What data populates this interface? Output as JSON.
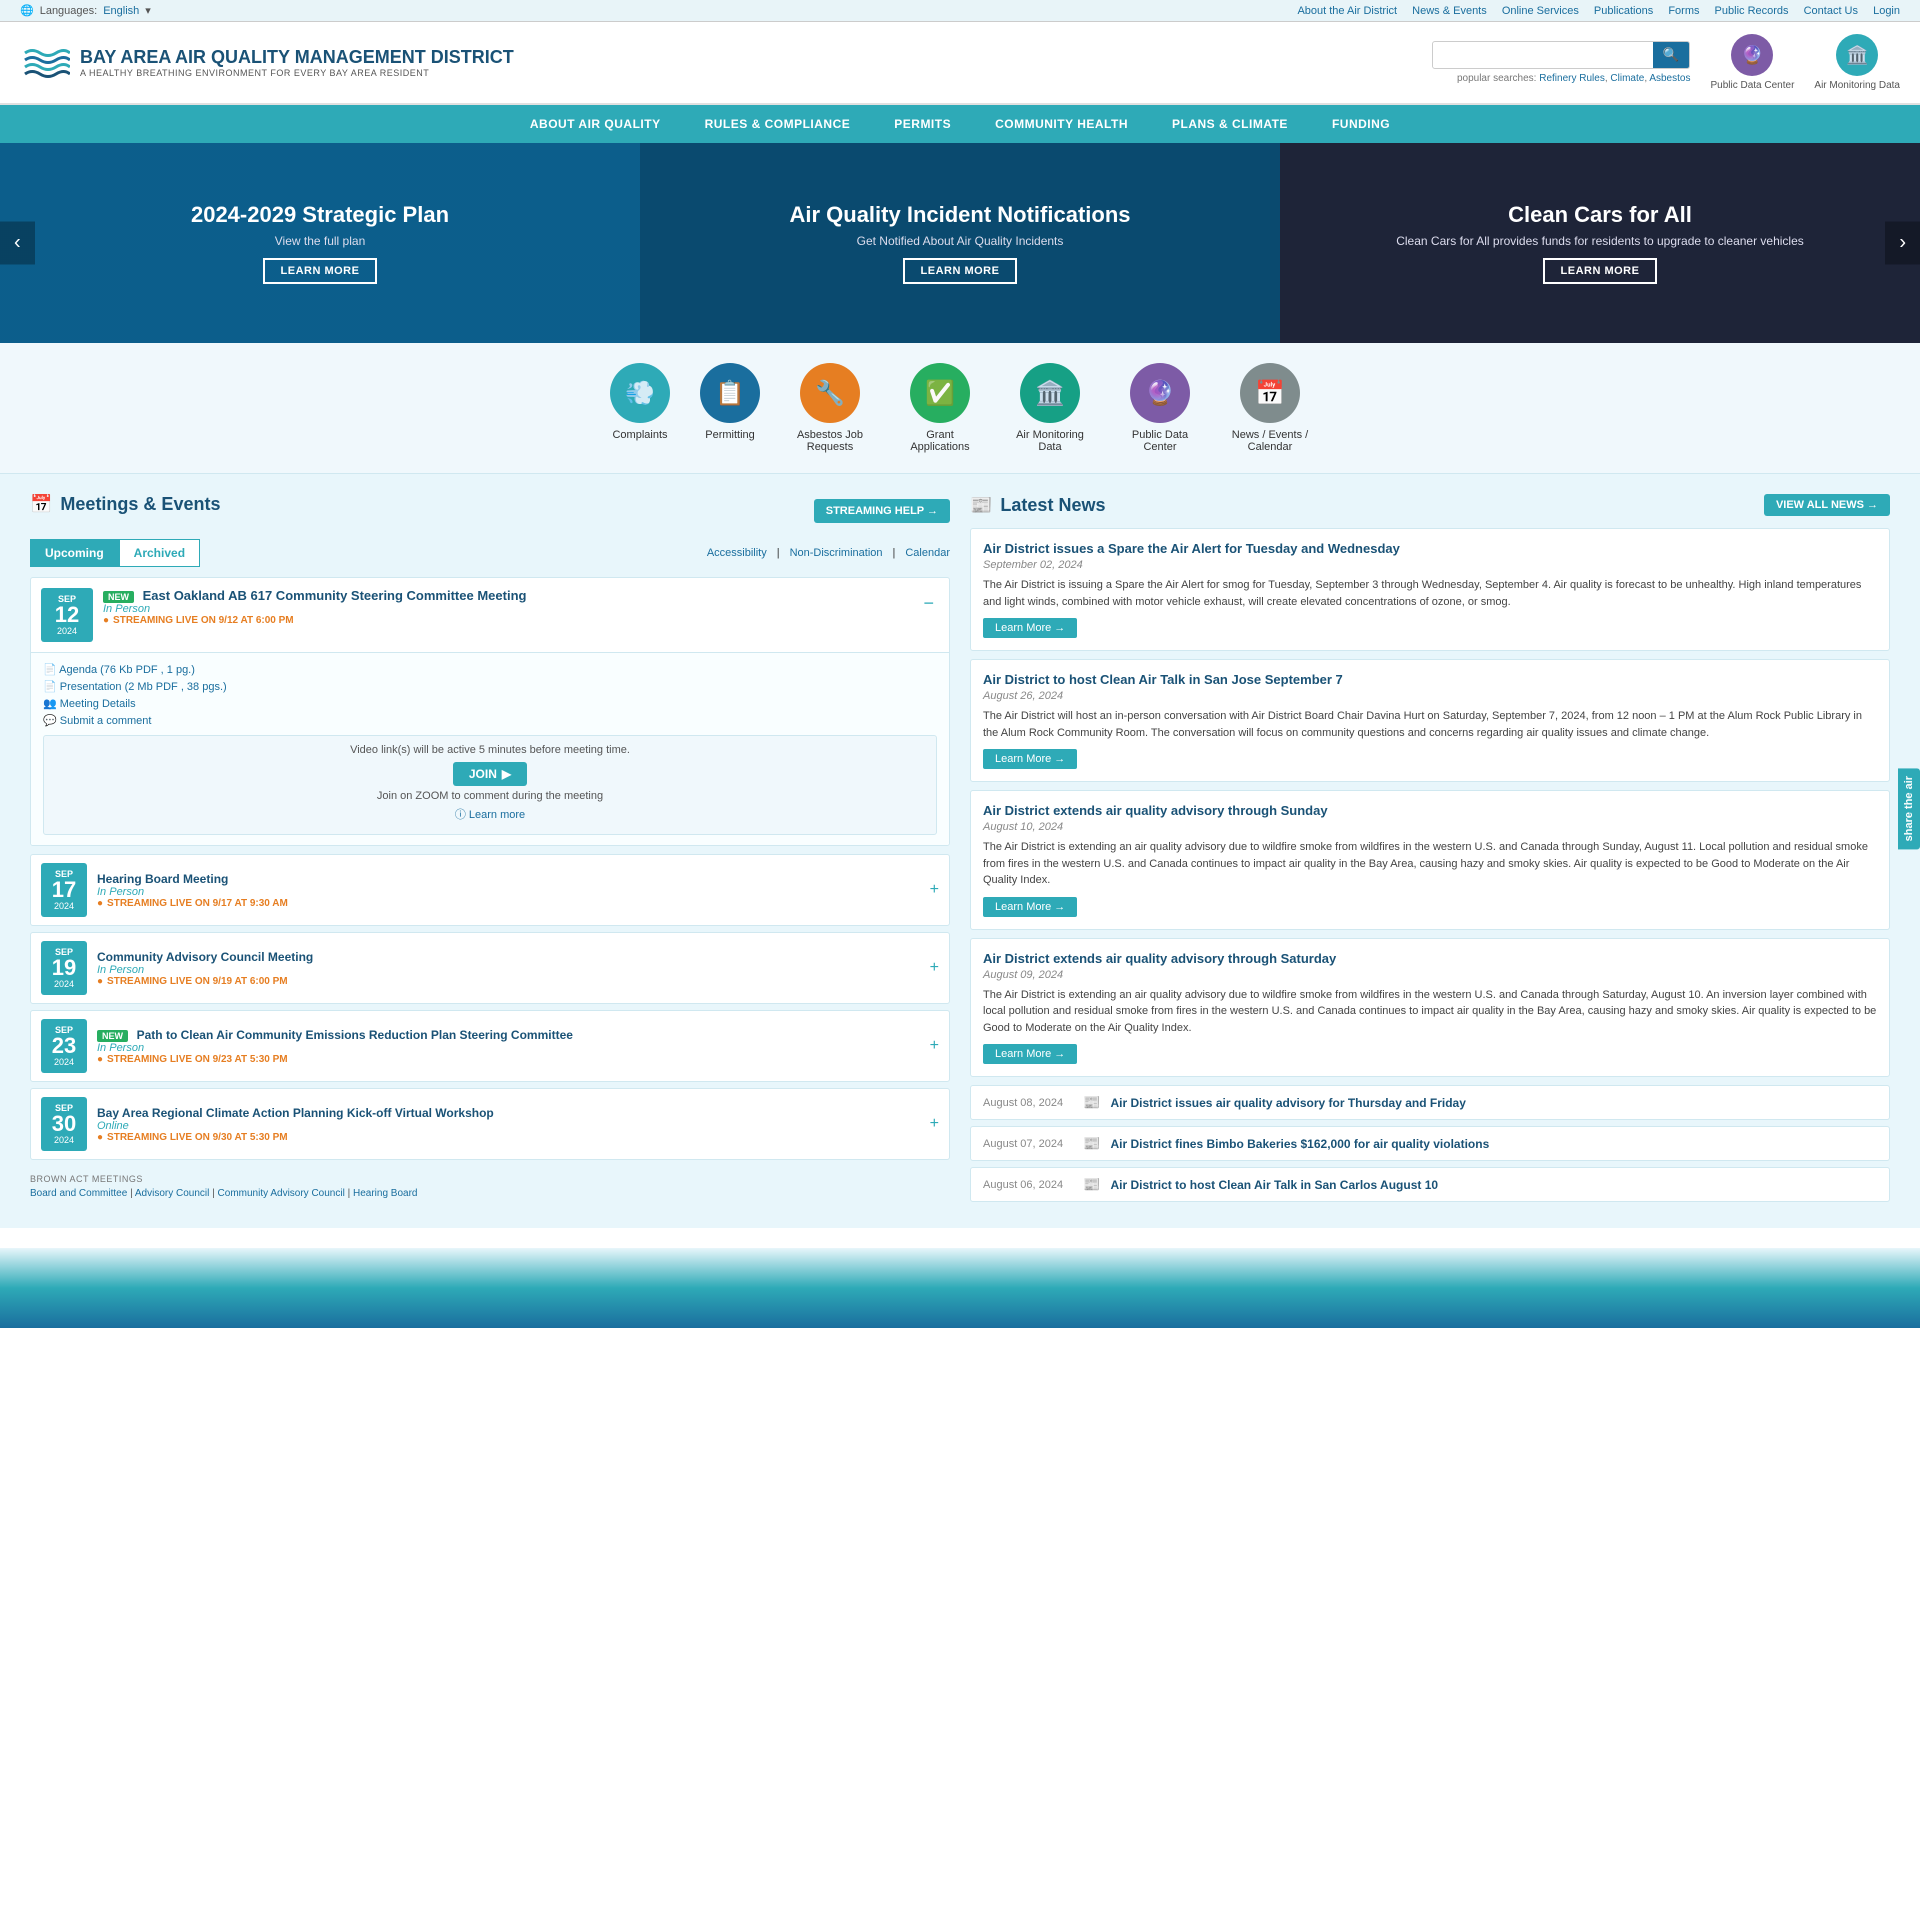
{
  "utility": {
    "language_label": "Languages:",
    "language_value": "English",
    "nav_links": [
      {
        "label": "About the Air District",
        "href": "#"
      },
      {
        "label": "News & Events",
        "href": "#"
      },
      {
        "label": "Online Services",
        "href": "#"
      },
      {
        "label": "Publications",
        "href": "#"
      },
      {
        "label": "Forms",
        "href": "#"
      },
      {
        "label": "Public Records",
        "href": "#"
      },
      {
        "label": "Contact Us",
        "href": "#"
      },
      {
        "label": "Login",
        "href": "#"
      }
    ]
  },
  "header": {
    "org_name": "Bay Area Air Quality Management District",
    "tagline": "A Healthy Breathing Environment for Every Bay Area Resident",
    "search_placeholder": "",
    "popular_searches_label": "popular searches:",
    "popular_searches": [
      {
        "label": "Refinery Rules"
      },
      {
        "label": "Climate"
      },
      {
        "label": "Asbestos"
      }
    ],
    "quick_links": [
      {
        "label": "Public Data Center",
        "icon": "🔮"
      },
      {
        "label": "Air Monitoring Data",
        "icon": "🏛️"
      }
    ]
  },
  "nav": {
    "items": [
      {
        "label": "About Air Quality"
      },
      {
        "label": "Rules & Compliance"
      },
      {
        "label": "Permits"
      },
      {
        "label": "Community Health"
      },
      {
        "label": "Plans & Climate"
      },
      {
        "label": "Funding"
      }
    ]
  },
  "hero": {
    "slides": [
      {
        "title": "2024-2029 Strategic Plan",
        "subtitle": "View the full plan",
        "btn_label": "LEARN MORE"
      },
      {
        "title": "Air Quality Incident Notifications",
        "subtitle": "Get Notified About Air Quality Incidents",
        "btn_label": "LEARN MORE"
      },
      {
        "title": "Clean Cars for All",
        "subtitle": "Clean Cars for All provides funds for residents to upgrade to cleaner vehicles",
        "btn_label": "LEARN MORE"
      }
    ],
    "prev_label": "‹",
    "next_label": "›"
  },
  "quick_icons": [
    {
      "label": "Complaints",
      "icon": "💨",
      "color": "qi-teal"
    },
    {
      "label": "Permitting",
      "icon": "📋",
      "color": "qi-blue"
    },
    {
      "label": "Asbestos Job Requests",
      "icon": "🔧",
      "color": "qi-orange"
    },
    {
      "label": "Grant Applications",
      "icon": "✅",
      "color": "qi-green"
    },
    {
      "label": "Air Monitoring Data",
      "icon": "🏛️",
      "color": "qi-cyan"
    },
    {
      "label": "Public Data Center",
      "icon": "🔮",
      "color": "qi-purple"
    },
    {
      "label": "News / Events / Calendar",
      "icon": "📅",
      "color": "qi-gray"
    }
  ],
  "meetings": {
    "section_title": "Meetings & Events",
    "streaming_help_label": "STREAMING HELP →",
    "tabs": [
      {
        "label": "Upcoming",
        "active": true
      },
      {
        "label": "Archived"
      }
    ],
    "links": [
      {
        "label": "Accessibility"
      },
      {
        "label": "Non-Discrimination"
      },
      {
        "label": "Calendar"
      }
    ],
    "events": [
      {
        "month": "SEP",
        "day": "12",
        "year": "2024",
        "badge": "NEW",
        "title": "East Oakland AB 617 Community Steering Committee Meeting",
        "type": "In Person",
        "streaming": "STREAMING LIVE ON 9/12 AT 6:00 PM",
        "expanded": true,
        "links": [
          {
            "label": "Agenda (76 Kb PDF , 1 pg.)",
            "icon": "📄"
          },
          {
            "label": "Presentation (2 Mb PDF , 38 pgs.)",
            "icon": "📄"
          },
          {
            "label": "Meeting Details",
            "icon": "👥"
          },
          {
            "label": "Submit a comment",
            "icon": "💬"
          }
        ],
        "streaming_info": "Video link(s) will be active 5 minutes before meeting time.",
        "join_label": "JOIN",
        "zoom_text": "Join on ZOOM to comment during the meeting",
        "learn_more": "Learn more"
      },
      {
        "month": "SEP",
        "day": "17",
        "year": "2024",
        "badge": "",
        "title": "Hearing Board Meeting",
        "type": "In Person",
        "streaming": "STREAMING LIVE ON 9/17 AT 9:30 AM",
        "expanded": false
      },
      {
        "month": "SEP",
        "day": "19",
        "year": "2024",
        "badge": "",
        "title": "Community Advisory Council Meeting",
        "type": "In Person",
        "streaming": "STREAMING LIVE ON 9/19 AT 6:00 PM",
        "expanded": false
      },
      {
        "month": "SEP",
        "day": "23",
        "year": "2024",
        "badge": "NEW",
        "title": "Path to Clean Air Community Emissions Reduction Plan Steering Committee",
        "type": "In Person",
        "streaming": "STREAMING LIVE ON 9/23 AT 5:30 PM",
        "expanded": false
      },
      {
        "month": "SEP",
        "day": "30",
        "year": "2024",
        "badge": "",
        "title": "Bay Area Regional Climate Action Planning Kick-off Virtual Workshop",
        "type": "Online",
        "streaming": "STREAMING LIVE ON 9/30 AT 5:30 PM",
        "expanded": false
      }
    ],
    "brown_act_label": "BROWN ACT MEETINGS",
    "brown_act_links": [
      {
        "label": "Board and Committee"
      },
      {
        "label": "Advisory Council"
      },
      {
        "label": "Community Advisory Council"
      },
      {
        "label": "Hearing Board"
      }
    ]
  },
  "news": {
    "section_title": "Latest News",
    "view_all_label": "VIEW ALL NEWS →",
    "featured": [
      {
        "title": "Air District issues a Spare the Air Alert for Tuesday and Wednesday",
        "date": "September 02, 2024",
        "body": "The Air District is issuing a Spare the Air Alert for smog for Tuesday, September 3 through Wednesday, September 4. Air quality is forecast to be unhealthy. High inland temperatures and light winds, combined with motor vehicle exhaust, will create elevated concentrations of ozone, or smog.",
        "btn_label": "Learn More →"
      },
      {
        "title": "Air District to host Clean Air Talk in San Jose September 7",
        "date": "August 26, 2024",
        "body": "The Air District will host an in-person conversation with Air District Board Chair Davina Hurt on Saturday, September 7, 2024, from 12 noon – 1 PM at the Alum Rock Public Library in the Alum Rock Community Room. The conversation will focus on community questions and concerns regarding air quality issues and climate change.",
        "btn_label": "Learn More →"
      },
      {
        "title": "Air District extends air quality advisory through Sunday",
        "date": "August 10, 2024",
        "body": "The Air District is extending an air quality advisory due to wildfire smoke from wildfires in the western U.S. and Canada through Sunday, August 11. Local pollution and residual smoke from fires in the western U.S. and Canada continues to impact air quality in the Bay Area, causing hazy and smoky skies. Air quality is expected to be Good to Moderate on the Air Quality Index.",
        "btn_label": "Learn More →"
      },
      {
        "title": "Air District extends air quality advisory through Saturday",
        "date": "August 09, 2024",
        "body": "The Air District is extending an air quality advisory due to wildfire smoke from wildfires in the western U.S. and Canada through Saturday, August 10. An inversion layer combined with local pollution and residual smoke from fires in the western U.S. and Canada continues to impact air quality in the Bay Area, causing hazy and smoky skies. Air quality is expected to be Good to Moderate on the Air Quality Index.",
        "btn_label": "Learn More →"
      }
    ],
    "list_items": [
      {
        "date": "August 08, 2024",
        "title": "Air District issues air quality advisory for Thursday and Friday"
      },
      {
        "date": "August 07, 2024",
        "title": "Air District fines Bimbo Bakeries $162,000 for air quality violations"
      },
      {
        "date": "August 06, 2024",
        "title": "Air District to host Clean Air Talk in San Carlos August 10"
      }
    ]
  },
  "share_sidebar": "share the air"
}
